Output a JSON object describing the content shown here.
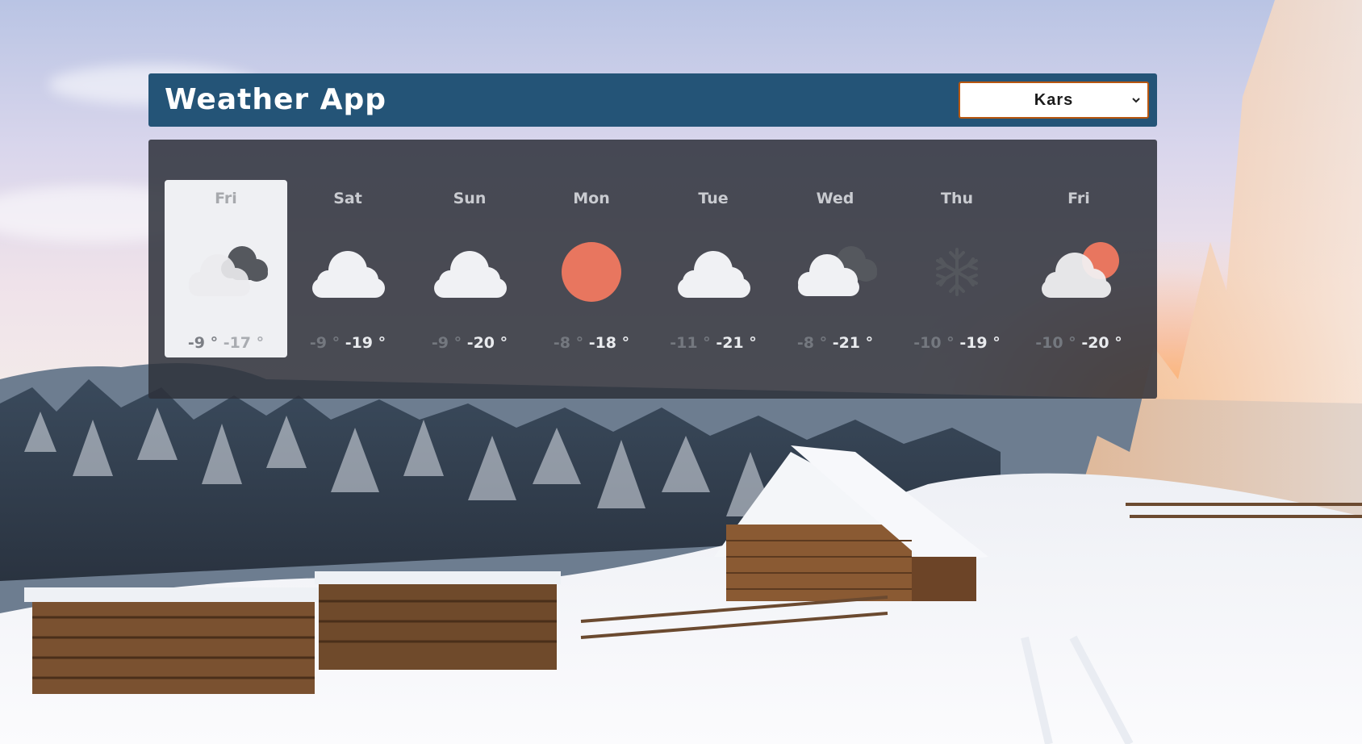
{
  "header": {
    "title": "Weather App",
    "city": "Kars"
  },
  "forecast": {
    "days": [
      {
        "day": "Fri",
        "max": "-9 °",
        "min": "-17 °",
        "icon": "cloudy-dark-icon",
        "selected": true
      },
      {
        "day": "Sat",
        "max": "-9 °",
        "min": "-19 °",
        "icon": "cloud-icon",
        "selected": false
      },
      {
        "day": "Sun",
        "max": "-9 °",
        "min": "-20 °",
        "icon": "cloud-icon",
        "selected": false
      },
      {
        "day": "Mon",
        "max": "-8 °",
        "min": "-18 °",
        "icon": "sun-icon",
        "selected": false
      },
      {
        "day": "Tue",
        "max": "-11 °",
        "min": "-21 °",
        "icon": "cloud-icon",
        "selected": false
      },
      {
        "day": "Wed",
        "max": "-8 °",
        "min": "-21 °",
        "icon": "cloudy-dark-icon",
        "selected": false
      },
      {
        "day": "Thu",
        "max": "-10 °",
        "min": "-19 °",
        "icon": "snowflake-icon",
        "selected": false
      },
      {
        "day": "Fri",
        "max": "-10 °",
        "min": "-20 °",
        "icon": "partly-sunny-icon",
        "selected": false
      }
    ]
  },
  "colors": {
    "header_bg": "#245477",
    "select_border": "#b8560f",
    "panel_bg": "#2d313a",
    "sun": "#e8765f",
    "cloud_light": "#f0f1f4",
    "cloud_dark": "#55585e"
  }
}
